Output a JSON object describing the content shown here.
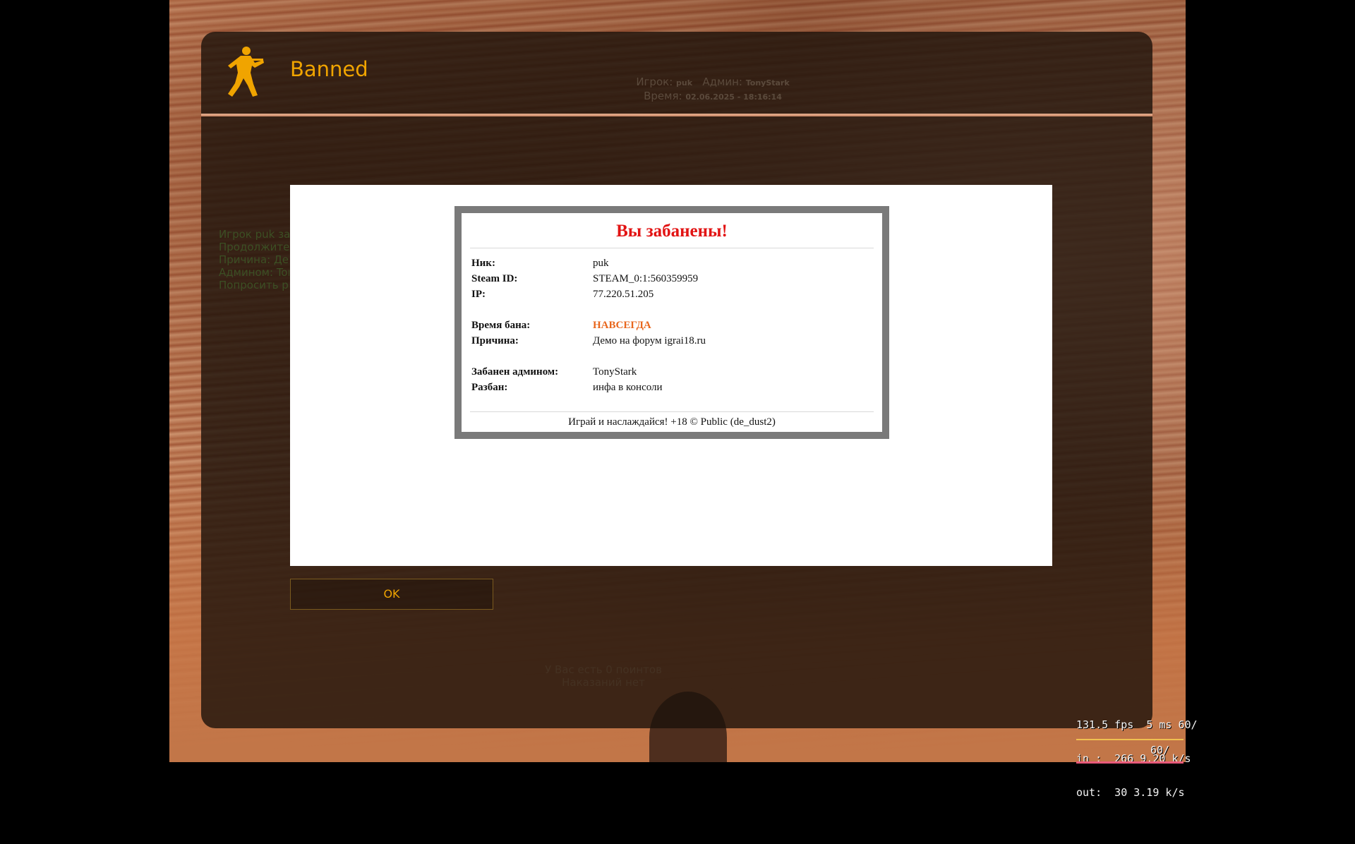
{
  "dialog": {
    "title": "Banned",
    "header_info": {
      "player_label": "Игрок:",
      "player": "puk",
      "admin_label": "Админ:",
      "admin": "TonyStark",
      "time_label": "Время:",
      "time": "02.06.2025 - 18:16:14"
    },
    "side_notes": [
      "Игрок puk заб",
      "Продолжите",
      "Причина: Дем",
      "Админом: Tony",
      "Попросить ра"
    ],
    "bottom_notes": [
      "У Вас есть 0 поинтов",
      "Наказаний нет"
    ],
    "ok_label": "OK"
  },
  "ban": {
    "title": "Вы забанены!",
    "rows": [
      {
        "label": "Ник:",
        "value": "puk"
      },
      {
        "label": "Steam ID:",
        "value": "STEAM_0:1:560359959"
      },
      {
        "label": "IP:",
        "value": "77.220.51.205"
      },
      {
        "label": "Время бана:",
        "value": "НАВСЕГДА"
      },
      {
        "label": "Причина:",
        "value": "Демо на форум igrai18.ru"
      },
      {
        "label": "Забанен админом:",
        "value": "TonyStark"
      },
      {
        "label": "Разбан:",
        "value": "инфа в консоли"
      }
    ],
    "footer": "Играй и наслаждайся! +18 © Public (de_dust2)",
    "highlight_color": "#e8661c",
    "title_color": "#e21414"
  },
  "netgraph": {
    "line1": "131.5 fps  5 ms 60/",
    "line2": "in :  266 9.20 k/s",
    "line3": "out:  30 3.19 k/s",
    "rate": "60/"
  }
}
